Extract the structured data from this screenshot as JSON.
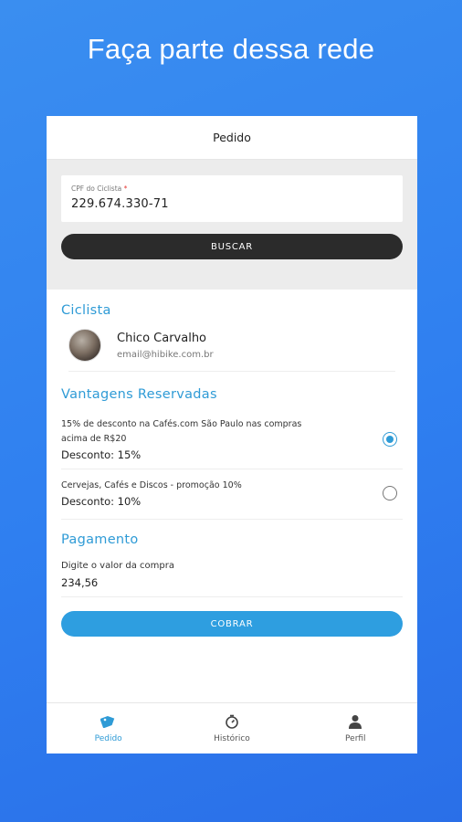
{
  "headline": "Faça parte dessa rede",
  "appbar": {
    "title": "Pedido"
  },
  "search": {
    "cpf_label": "CPF do Ciclista",
    "cpf_required_mark": "*",
    "cpf_value": "229.674.330-71",
    "button_label": "BUSCAR"
  },
  "ciclista": {
    "section_title": "Ciclista",
    "name": "Chico Carvalho",
    "email": "email@hibike.com.br"
  },
  "vantagens": {
    "section_title": "Vantagens Reservadas",
    "items": [
      {
        "description": "15% de desconto na Cafés.com São Paulo nas compras acima de R$20",
        "discount": "Desconto: 15%",
        "selected": true
      },
      {
        "description": "Cervejas, Cafés e Discos - promoção 10%",
        "discount": "Desconto: 10%",
        "selected": false
      }
    ]
  },
  "pagamento": {
    "section_title": "Pagamento",
    "valor_label": "Digite o valor da compra",
    "valor_value": "234,56",
    "button_label": "COBRAR"
  },
  "nav": {
    "items": [
      {
        "label": "Pedido",
        "icon": "tag-icon",
        "active": true
      },
      {
        "label": "Histórico",
        "icon": "timer-icon",
        "active": false
      },
      {
        "label": "Perfil",
        "icon": "person-icon",
        "active": false
      }
    ]
  },
  "colors": {
    "background": "#2f7ff0",
    "accent": "#2f9bd6",
    "dark_button": "#2b2b2b",
    "cobrar_button": "#2e9ee0"
  }
}
